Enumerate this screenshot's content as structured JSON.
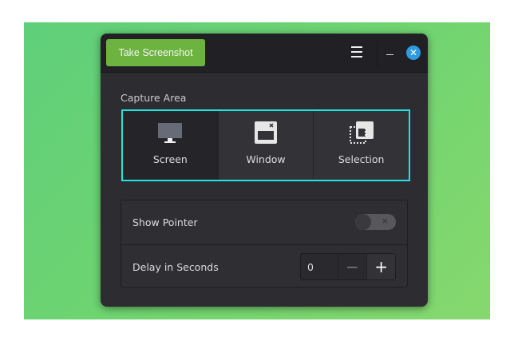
{
  "header": {
    "take_screenshot": "Take Screenshot",
    "menu_icon": "hamburger-menu-icon",
    "minimize_icon": "minimize-icon",
    "close_icon": "close-icon"
  },
  "capture": {
    "label": "Capture Area",
    "options": [
      {
        "label": "Screen",
        "selected": true
      },
      {
        "label": "Window",
        "selected": false
      },
      {
        "label": "Selection",
        "selected": false
      }
    ]
  },
  "settings": {
    "show_pointer": {
      "label": "Show Pointer",
      "enabled": false,
      "toggle_mark": "×"
    },
    "delay": {
      "label": "Delay in Seconds",
      "value": "0",
      "minus": "−",
      "plus": "+"
    }
  },
  "colors": {
    "accent": "#6db33f",
    "focus": "#1fe5e5",
    "close": "#2d9be0"
  }
}
